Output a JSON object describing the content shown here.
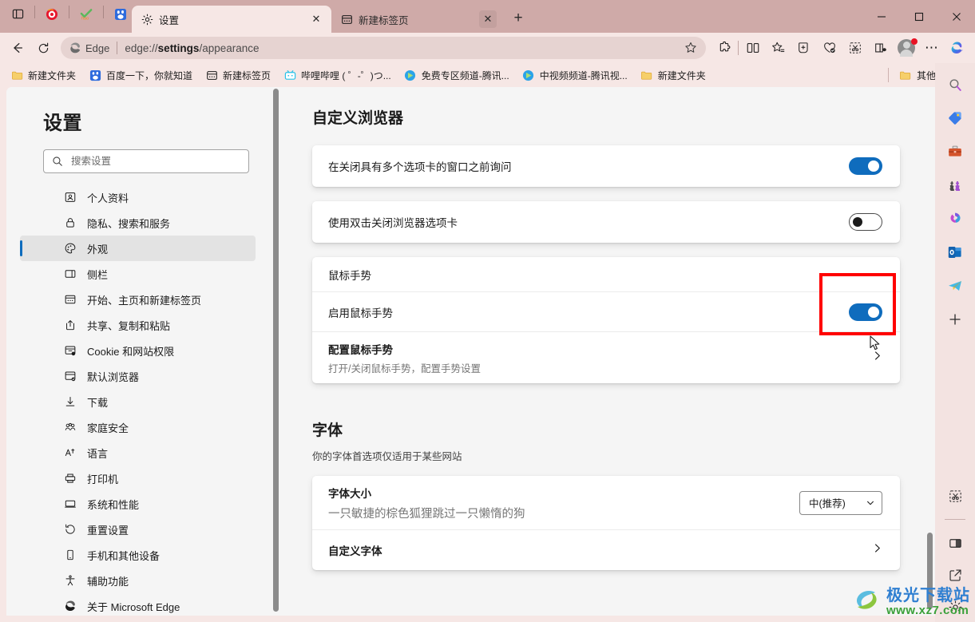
{
  "window": {
    "minimize_label": "—",
    "maximize_label": "☐",
    "close_label": "✕"
  },
  "tabs": {
    "new_tab_label": "+",
    "items": [
      {
        "title": "设置",
        "icon": "gear-icon",
        "active": true,
        "close_label": "✕"
      },
      {
        "title": "新建标签页",
        "icon": "newtab-page-icon",
        "active": false,
        "close_label": "✕"
      }
    ]
  },
  "quick_icons": [
    {
      "name": "tab-list-icon",
      "glyph": "▤"
    },
    {
      "name": "weibo-icon",
      "glyph": ""
    },
    {
      "name": "hao123-icon",
      "glyph": ""
    },
    {
      "name": "baidu-icon",
      "glyph": ""
    }
  ],
  "nav": {
    "back_label": "←",
    "reload_label": "↻",
    "edge_label": "Edge",
    "url_prefix": "edge://",
    "url_bold": "settings",
    "url_suffix": "/appearance",
    "favorite_label": "☆"
  },
  "toolbar_icons": [
    {
      "name": "extensions-icon"
    },
    {
      "name": "split-screen-icon"
    },
    {
      "name": "favorites-icon"
    },
    {
      "name": "collections-icon"
    },
    {
      "name": "browser-essentials-icon"
    },
    {
      "name": "screenshot-icon"
    },
    {
      "name": "read-aloud-icon"
    },
    {
      "name": "profile-avatar"
    },
    {
      "name": "settings-more-icon",
      "glyph": "⋯"
    },
    {
      "name": "copilot-icon"
    }
  ],
  "bookmarks": {
    "items": [
      {
        "label": "新建文件夹",
        "icon": "folder-icon"
      },
      {
        "label": "百度一下，你就知道",
        "icon": "baidu-icon"
      },
      {
        "label": "新建标签页",
        "icon": "newtab-page-icon"
      },
      {
        "label": "哔哩哔哩 ( ゜-゜)つ...",
        "icon": "bilibili-icon"
      },
      {
        "label": "免费专区频道-腾讯...",
        "icon": "tencent-video-icon"
      },
      {
        "label": "中视频频道-腾讯视...",
        "icon": "tencent-video-icon"
      },
      {
        "label": "新建文件夹",
        "icon": "folder-icon"
      }
    ],
    "other_favorites": {
      "label": "其他收藏夹",
      "icon": "folder-icon"
    }
  },
  "sidebar": {
    "title": "设置",
    "search": {
      "placeholder": "搜索设置",
      "value": "",
      "icon": "search-icon"
    },
    "items": [
      {
        "label": "个人资料",
        "icon": "profile-icon",
        "active": false
      },
      {
        "label": "隐私、搜索和服务",
        "icon": "lock-icon",
        "active": false
      },
      {
        "label": "外观",
        "icon": "palette-icon",
        "active": true
      },
      {
        "label": "侧栏",
        "icon": "sidebar-icon",
        "active": false
      },
      {
        "label": "开始、主页和新建标签页",
        "icon": "home-page-icon",
        "active": false
      },
      {
        "label": "共享、复制和粘贴",
        "icon": "share-icon",
        "active": false
      },
      {
        "label": "Cookie 和网站权限",
        "icon": "cookie-icon",
        "active": false
      },
      {
        "label": "默认浏览器",
        "icon": "default-browser-icon",
        "active": false
      },
      {
        "label": "下载",
        "icon": "download-icon",
        "active": false
      },
      {
        "label": "家庭安全",
        "icon": "family-icon",
        "active": false
      },
      {
        "label": "语言",
        "icon": "language-icon",
        "active": false
      },
      {
        "label": "打印机",
        "icon": "printer-icon",
        "active": false
      },
      {
        "label": "系统和性能",
        "icon": "system-icon",
        "active": false
      },
      {
        "label": "重置设置",
        "icon": "reset-icon",
        "active": false
      },
      {
        "label": "手机和其他设备",
        "icon": "phone-icon",
        "active": false
      },
      {
        "label": "辅助功能",
        "icon": "accessibility-icon",
        "active": false
      },
      {
        "label": "关于 Microsoft Edge",
        "icon": "edge-logo-icon",
        "active": false
      }
    ]
  },
  "content": {
    "section1_title": "自定义浏览器",
    "rows": {
      "ask_before_closing": {
        "label": "在关闭具有多个选项卡的窗口之前询问",
        "toggle": "on"
      },
      "double_click_close": {
        "label": "使用双击关闭浏览器选项卡",
        "toggle": "off"
      },
      "mouse_gesture_header": {
        "label": "鼠标手势"
      },
      "enable_mouse_gesture": {
        "label": "启用鼠标手势",
        "toggle": "on",
        "highlighted": true
      },
      "configure_mouse_gesture": {
        "label": "配置鼠标手势",
        "sub": "打开/关闭鼠标手势，配置手势设置",
        "chevron": "›"
      }
    },
    "section2_title": "字体",
    "section2_sub": "你的字体首选项仅适用于某些网站",
    "font_size": {
      "label": "字体大小",
      "sample": "一只敏捷的棕色狐狸跳过一只懒惰的狗",
      "select_value": "中(推荐)",
      "select_chevron": "⌄"
    },
    "custom_fonts": {
      "label": "自定义字体",
      "chevron": "›"
    }
  },
  "right_rail": [
    {
      "name": "search-icon"
    },
    {
      "name": "shopping-tag-icon"
    },
    {
      "name": "briefcase-icon"
    },
    {
      "name": "games-icon"
    },
    {
      "name": "microsoft365-icon"
    },
    {
      "name": "outlook-icon"
    },
    {
      "name": "telegram-icon"
    },
    {
      "name": "add-sidebar-app-icon",
      "glyph": "+"
    },
    {
      "name": "screenshot-tool-icon"
    },
    {
      "name": "split-view-icon"
    },
    {
      "name": "open-external-icon"
    },
    {
      "name": "sidebar-settings-icon"
    }
  ],
  "watermark": {
    "line1": "极光下载站",
    "line2": "www.xz7.com"
  },
  "colors": {
    "accent": "#0f6cbd",
    "titlebar": "#cfaaa8",
    "chrome": "#f6e7e5",
    "page_bg": "#f5f5f5",
    "highlight_box": "#ff0000"
  }
}
